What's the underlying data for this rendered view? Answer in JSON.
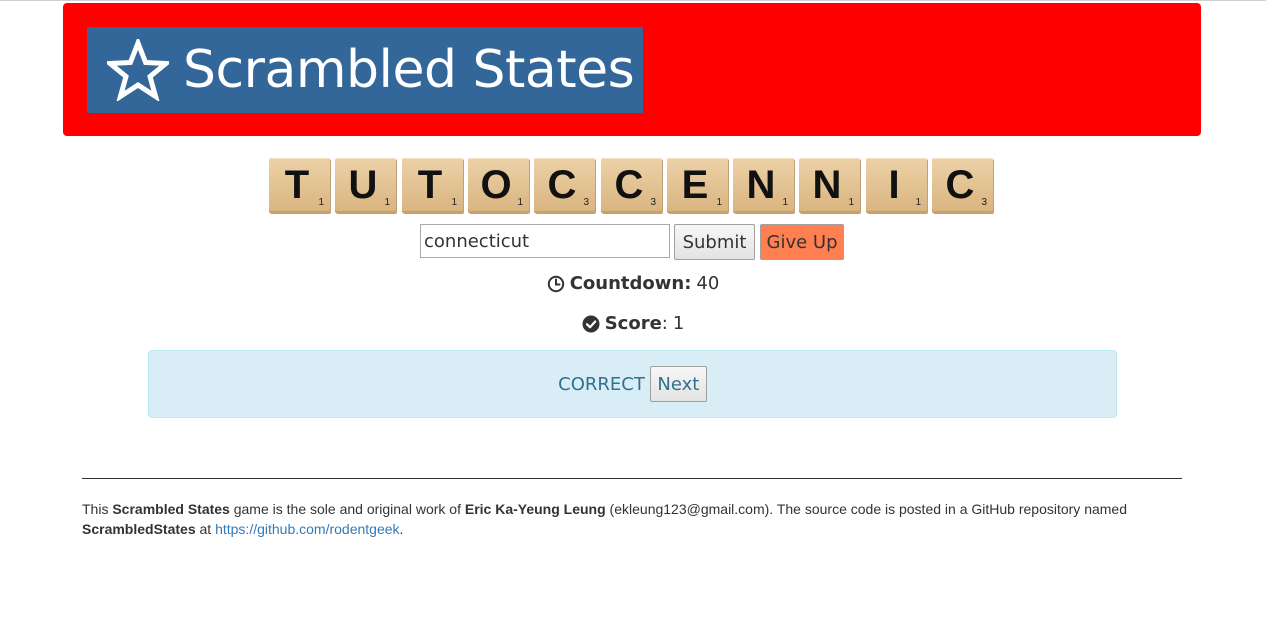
{
  "header": {
    "title": "Scrambled States",
    "title_bg": "#336699",
    "header_bg": "#ff0000"
  },
  "tiles": [
    {
      "letter": "T",
      "score": "1"
    },
    {
      "letter": "U",
      "score": "1"
    },
    {
      "letter": "T",
      "score": "1"
    },
    {
      "letter": "O",
      "score": "1"
    },
    {
      "letter": "C",
      "score": "3"
    },
    {
      "letter": "C",
      "score": "3"
    },
    {
      "letter": "E",
      "score": "1"
    },
    {
      "letter": "N",
      "score": "1"
    },
    {
      "letter": "N",
      "score": "1"
    },
    {
      "letter": "I",
      "score": "1"
    },
    {
      "letter": "C",
      "score": "3"
    }
  ],
  "answer": {
    "value": "connecticut",
    "submit_label": "Submit",
    "giveup_label": "Give Up",
    "giveup_color": "#ff7f50"
  },
  "countdown": {
    "label": "Countdown:",
    "value": "40",
    "icon": "clock-icon"
  },
  "score": {
    "label": "Score",
    "colon": ":",
    "value": "1",
    "icon": "check-circle-icon"
  },
  "result": {
    "text": "CORRECT",
    "next_label": "Next"
  },
  "footer": {
    "t1": "This ",
    "b1": "Scrambled States",
    "t2": " game is the sole and original work of ",
    "b2": "Eric Ka-Yeung Leung",
    "t3": " (ekleung123@gmail.com).  The source code is posted in a GitHub repository named ",
    "b3": "ScrambledStates",
    "t4": " at ",
    "link": "https://github.com/rodentgeek",
    "t5": "."
  }
}
